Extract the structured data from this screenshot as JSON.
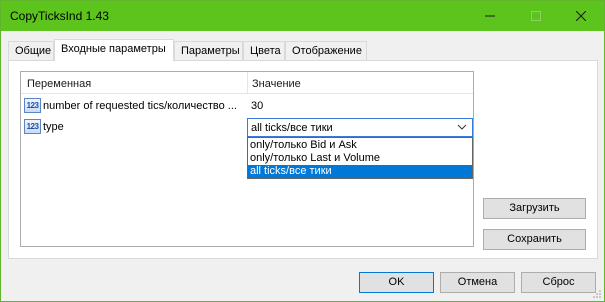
{
  "window": {
    "title": "CopyTicksInd 1.43"
  },
  "titlebar": {
    "minimize_icon": "minimize-icon",
    "maximize_icon": "maximize-icon",
    "close_icon": "close-icon",
    "color": "#5cc41c"
  },
  "tabs": [
    {
      "label": "Общие",
      "active": false
    },
    {
      "label": "Входные параметры",
      "active": true
    },
    {
      "label": "Параметры",
      "active": false
    },
    {
      "label": "Цвета",
      "active": false
    },
    {
      "label": "Отображение",
      "active": false
    }
  ],
  "grid": {
    "headers": {
      "variable": "Переменная",
      "value": "Значение"
    },
    "rows": [
      {
        "icon": "123",
        "name": "number of requested tics/количество ...",
        "value": "30"
      },
      {
        "icon": "123",
        "name": "type",
        "value": "all ticks/все тики"
      }
    ],
    "dropdown": {
      "options": [
        {
          "label": "only/только Bid и Ask",
          "selected": false
        },
        {
          "label": "only/только Last и Volume",
          "selected": false
        },
        {
          "label": "all ticks/все тики",
          "selected": true
        }
      ]
    }
  },
  "side_buttons": {
    "load": "Загрузить",
    "save": "Сохранить"
  },
  "footer_buttons": {
    "ok": "OK",
    "cancel": "Отмена",
    "reset": "Сброс"
  },
  "colors": {
    "accent": "#0078d7",
    "selection": "#0078d7"
  }
}
